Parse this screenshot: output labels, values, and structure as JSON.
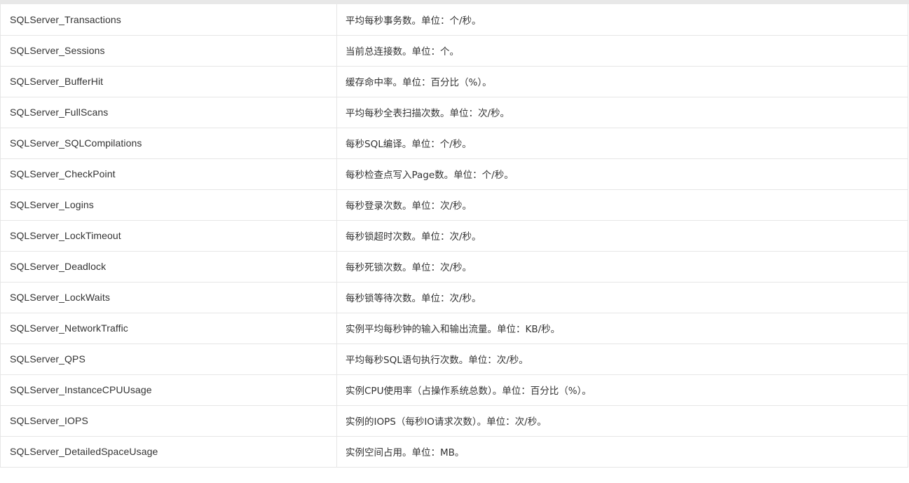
{
  "metrics": [
    {
      "name": "SQLServer_Transactions",
      "description": "平均每秒事务数。单位：个/秒。"
    },
    {
      "name": "SQLServer_Sessions",
      "description": "当前总连接数。单位：个。"
    },
    {
      "name": "SQLServer_BufferHit",
      "description": "缓存命中率。单位：百分比（%）。"
    },
    {
      "name": "SQLServer_FullScans",
      "description": "平均每秒全表扫描次数。单位：次/秒。"
    },
    {
      "name": "SQLServer_SQLCompilations",
      "description": "每秒SQL编译。单位：个/秒。"
    },
    {
      "name": "SQLServer_CheckPoint",
      "description": "每秒检查点写入Page数。单位：个/秒。"
    },
    {
      "name": "SQLServer_Logins",
      "description": "每秒登录次数。单位：次/秒。"
    },
    {
      "name": "SQLServer_LockTimeout",
      "description": "每秒锁超时次数。单位：次/秒。"
    },
    {
      "name": "SQLServer_Deadlock",
      "description": "每秒死锁次数。单位：次/秒。"
    },
    {
      "name": "SQLServer_LockWaits",
      "description": "每秒锁等待次数。单位：次/秒。"
    },
    {
      "name": "SQLServer_NetworkTraffic",
      "description": "实例平均每秒钟的输入和输出流量。单位：KB/秒。"
    },
    {
      "name": "SQLServer_QPS",
      "description": "平均每秒SQL语句执行次数。单位：次/秒。"
    },
    {
      "name": "SQLServer_InstanceCPUUsage",
      "description": "实例CPU使用率（占操作系统总数）。单位：百分比（%）。"
    },
    {
      "name": "SQLServer_IOPS",
      "description": "实例的IOPS（每秒IO请求次数）。单位：次/秒。"
    },
    {
      "name": "SQLServer_DetailedSpaceUsage",
      "description": "实例空间占用。单位：MB。"
    }
  ]
}
